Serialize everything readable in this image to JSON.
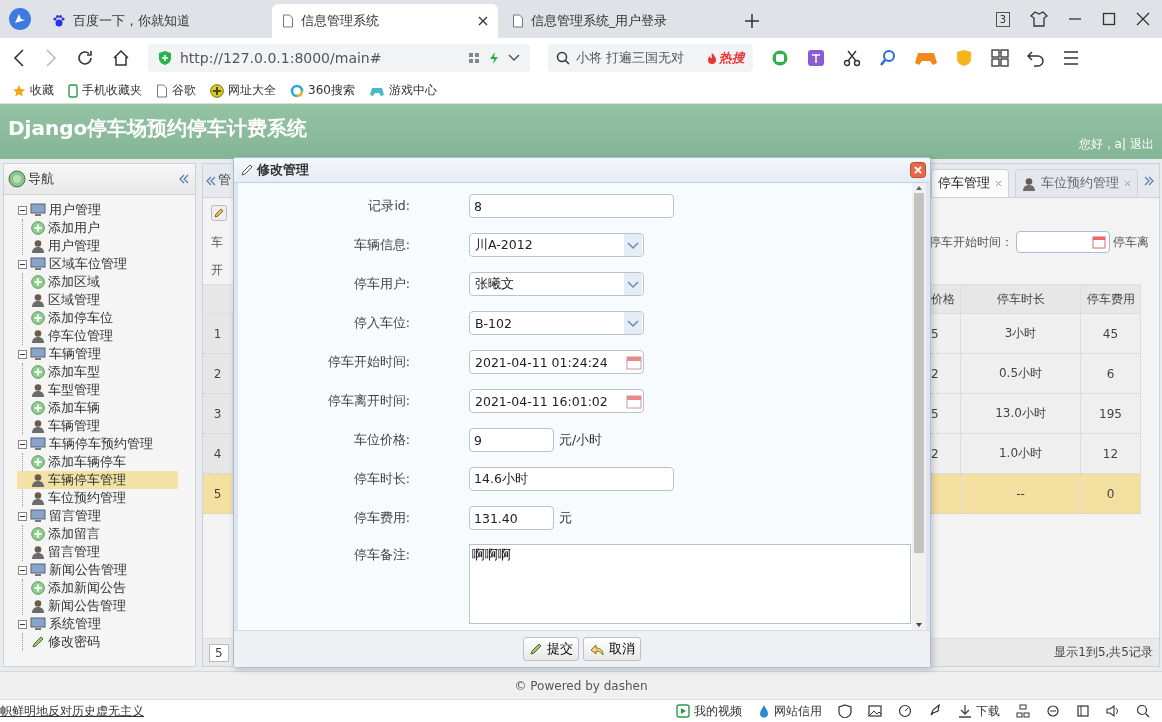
{
  "browser": {
    "tabs": [
      {
        "label": "百度一下，你就知道",
        "kind": "paw",
        "selected": false
      },
      {
        "label": "信息管理系统",
        "kind": "page",
        "selected": true
      },
      {
        "label": "信息管理系统_用户登录",
        "kind": "page",
        "selected": false
      }
    ],
    "window_count": "3",
    "url": "http://127.0.0.1:8000/main#",
    "search": {
      "value": "小将 打遍三国无对",
      "hot": "热搜"
    },
    "bookmarks": [
      {
        "label": "收藏",
        "kind": "star"
      },
      {
        "label": "手机收藏夹",
        "kind": "phone"
      },
      {
        "label": "谷歌",
        "kind": "page"
      },
      {
        "label": "网址大全",
        "kind": "plus"
      },
      {
        "label": "360搜索",
        "kind": "ring"
      },
      {
        "label": "游戏中心",
        "kind": "game"
      }
    ]
  },
  "app": {
    "title": "Django停车场预约停车计费系统",
    "greeting": "您好，a|",
    "logout": "退出"
  },
  "sidebar": {
    "title": "导航",
    "groups": [
      {
        "label": "用户管理",
        "expanded": true,
        "children": [
          {
            "label": "添加用户",
            "kind": "add",
            "selected": false
          },
          {
            "label": "用户管理",
            "kind": "manage",
            "selected": false
          }
        ]
      },
      {
        "label": "区域车位管理",
        "expanded": true,
        "children": [
          {
            "label": "添加区域",
            "kind": "add",
            "selected": false
          },
          {
            "label": "区域管理",
            "kind": "manage",
            "selected": false
          },
          {
            "label": "添加停车位",
            "kind": "add",
            "selected": false
          },
          {
            "label": "停车位管理",
            "kind": "manage",
            "selected": false
          }
        ]
      },
      {
        "label": "车辆管理",
        "expanded": true,
        "children": [
          {
            "label": "添加车型",
            "kind": "add",
            "selected": false
          },
          {
            "label": "车型管理",
            "kind": "manage",
            "selected": false
          },
          {
            "label": "添加车辆",
            "kind": "add",
            "selected": false
          },
          {
            "label": "车辆管理",
            "kind": "manage",
            "selected": false
          }
        ]
      },
      {
        "label": "车辆停车预约管理",
        "expanded": true,
        "children": [
          {
            "label": "添加车辆停车",
            "kind": "add",
            "selected": false
          },
          {
            "label": "车辆停车管理",
            "kind": "manage",
            "selected": true
          },
          {
            "label": "车位预约管理",
            "kind": "manage",
            "selected": false
          }
        ]
      },
      {
        "label": "留言管理",
        "expanded": true,
        "children": [
          {
            "label": "添加留言",
            "kind": "add",
            "selected": false
          },
          {
            "label": "留言管理",
            "kind": "manage",
            "selected": false
          }
        ]
      },
      {
        "label": "新闻公告管理",
        "expanded": true,
        "children": [
          {
            "label": "添加新闻公告",
            "kind": "add",
            "selected": false
          },
          {
            "label": "新闻公告管理",
            "kind": "manage",
            "selected": false
          }
        ]
      },
      {
        "label": "系统管理",
        "expanded": true,
        "children": [
          {
            "label": "修改密码",
            "kind": "edit",
            "selected": false
          }
        ]
      }
    ]
  },
  "main": {
    "tabs": [
      {
        "label": "管",
        "selected": false
      },
      {
        "label": "停车管理",
        "selected": true
      },
      {
        "label": "车位预约管理",
        "selected": false
      }
    ],
    "toolbar": {
      "cut_labels": [
        "车",
        "开"
      ],
      "filter_label": "停车开始时间：",
      "next_label": "停车离"
    },
    "table": {
      "columns": [
        "价格",
        "停车时长",
        "停车费用"
      ],
      "rows": [
        {
          "number": "1",
          "price": "5",
          "duration": "3小时",
          "fee": "45",
          "selected": false
        },
        {
          "number": "2",
          "price": "2",
          "duration": "0.5小时",
          "fee": "6",
          "selected": false
        },
        {
          "number": "3",
          "price": "5",
          "duration": "13.0小时",
          "fee": "195",
          "selected": false
        },
        {
          "number": "4",
          "price": "2",
          "duration": "1.0小时",
          "fee": "12",
          "selected": false
        },
        {
          "number": "5",
          "duration": "--",
          "fee": "0",
          "selected": true
        }
      ]
    },
    "pager": {
      "page_size": "5",
      "info": "显示1到5,共5记录"
    }
  },
  "dialog": {
    "title": "修改管理",
    "fields": [
      {
        "label": "记录id:",
        "kind": "text",
        "value": "8"
      },
      {
        "label": "车辆信息:",
        "kind": "select",
        "value": "川A-2012"
      },
      {
        "label": "停车用户:",
        "kind": "select",
        "value": "张曦文"
      },
      {
        "label": "停入车位:",
        "kind": "select",
        "value": "B-102"
      },
      {
        "label": "停车开始时间:",
        "kind": "date",
        "value": "2021-04-11 01:24:24"
      },
      {
        "label": "停车离开时间:",
        "kind": "date",
        "value": "2021-04-11 16:01:02"
      },
      {
        "label": "车位价格:",
        "kind": "short",
        "value": "9",
        "unit": "元/小时"
      },
      {
        "label": "停车时长:",
        "kind": "text",
        "value": "14.6小时"
      },
      {
        "label": "停车费用:",
        "kind": "short",
        "value": "131.40",
        "unit": "元"
      },
      {
        "label": "停车备注:",
        "kind": "textarea",
        "value": "啊啊啊"
      }
    ],
    "buttons": [
      {
        "label": "提交",
        "kind": "edit"
      },
      {
        "label": "取消",
        "kind": "undo"
      }
    ]
  },
  "footer": "© Powered by dashen",
  "status_bar": {
    "news": "帜鲜明地反对历史虚无主义",
    "items": [
      {
        "label": "我的视频",
        "kind": "video"
      },
      {
        "label": "网站信用",
        "kind": "drop"
      },
      {
        "label": "下载",
        "kind": "download"
      }
    ]
  }
}
